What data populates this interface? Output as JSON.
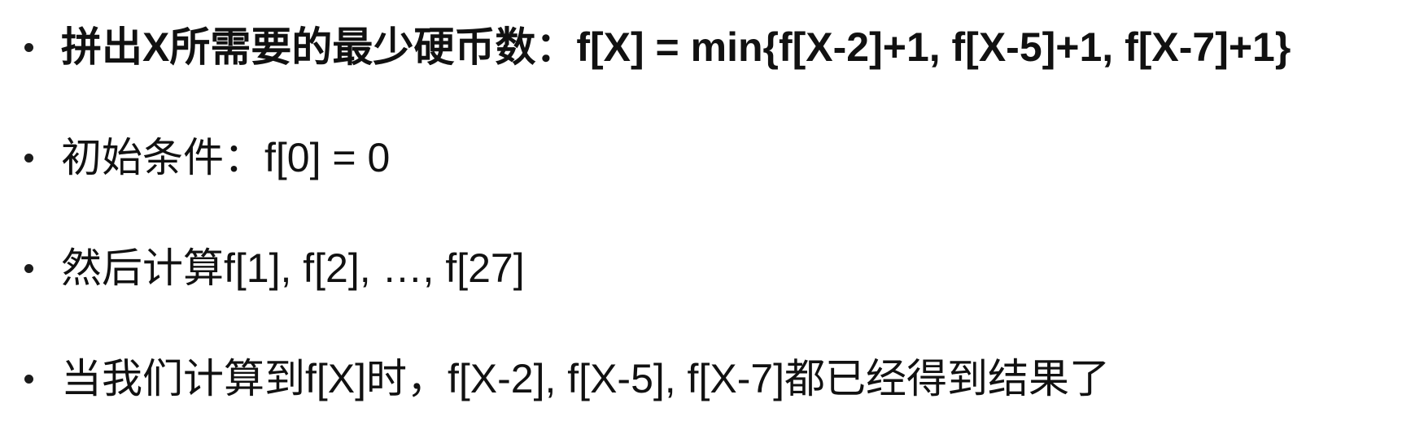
{
  "bullets": [
    {
      "text": "拼出X所需要的最少硬币数：f[X] = min{f[X-2]+1, f[X-5]+1, f[X-7]+1}",
      "bold": true
    },
    {
      "text": "初始条件：f[0] = 0",
      "bold": false
    },
    {
      "text": "然后计算f[1], f[2], …, f[27]",
      "bold": false
    },
    {
      "text": "当我们计算到f[X]时，f[X-2], f[X-5], f[X-7]都已经得到结果了",
      "bold": false
    }
  ]
}
